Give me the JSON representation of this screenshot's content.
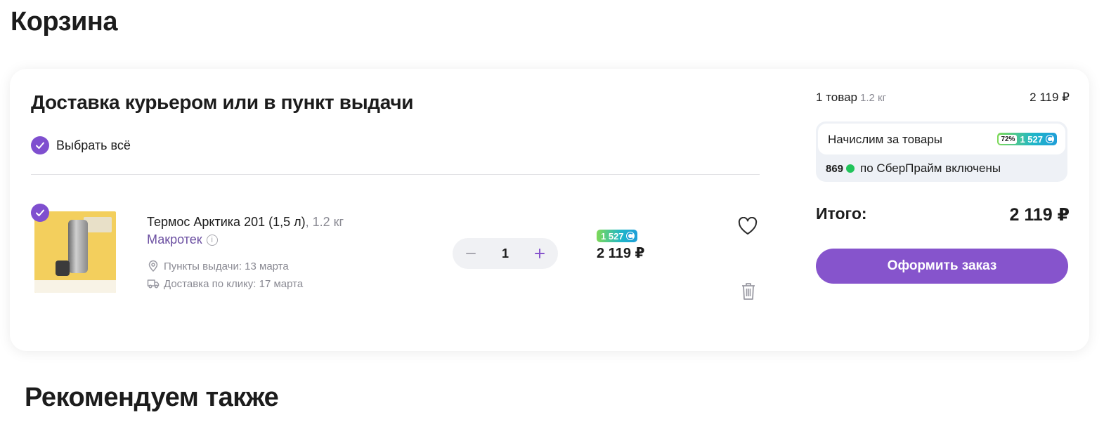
{
  "page_title": "Корзина",
  "section": {
    "title": "Доставка курьером или в пункт выдачи",
    "select_all_label": "Выбрать всё"
  },
  "item": {
    "name": "Термос Арктика 201 (1,5 л)",
    "weight": ", 1.2 кг",
    "seller": "Макротек",
    "pickup": "Пункты выдачи: 13 марта",
    "courier": "Доставка по клику: 17 марта",
    "quantity": "1",
    "bonus": "1 527",
    "price": "2 119 ₽"
  },
  "summary": {
    "count": "1 товар",
    "weight": "1.2 кг",
    "sum": "2 119 ₽",
    "accrue_label": "Начислим за товары",
    "bonus_percent": "72%",
    "bonus_amount": "1 527",
    "sber_amount": "869",
    "sber_label": "по СберПрайм включены",
    "total_label": "Итого:",
    "total_value": "2 119 ₽",
    "checkout_label": "Оформить заказ"
  },
  "recommend_title": "Рекомендуем также",
  "colors": {
    "accent": "#8654cc",
    "seller": "#6b4fa1",
    "muted": "#8a8a93"
  },
  "icons": [
    "check-icon",
    "info-icon",
    "location-pin-icon",
    "truck-icon",
    "minus-icon",
    "plus-icon",
    "coin-icon",
    "heart-icon",
    "trash-icon"
  ]
}
